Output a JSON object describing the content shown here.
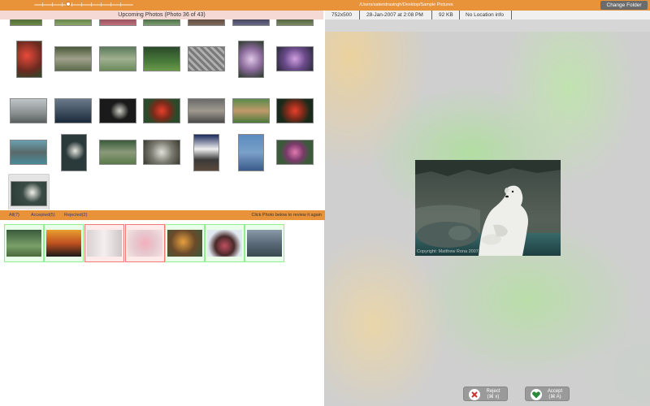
{
  "topbar": {
    "path": "/Users/satendrasingh/Desktop/Sample Pictures",
    "change_folder_label": "Change Folder"
  },
  "upcoming": {
    "header": "Upcoming Photos (Photo 36 of 43)"
  },
  "filters": {
    "all_label": "All(7)",
    "accepted_label": "Accepted(5)",
    "rejected_label": "Rejected(2)",
    "hint": "Click Photo below to review it again"
  },
  "review_items": [
    {
      "status": "accepted"
    },
    {
      "status": "accepted"
    },
    {
      "status": "rejected"
    },
    {
      "status": "rejected"
    },
    {
      "status": "accepted"
    },
    {
      "status": "accepted"
    },
    {
      "status": "accepted"
    }
  ],
  "info": {
    "dimensions": "752x500",
    "date": "28-Jan-2007 at 2:08 PM",
    "size": "92 KB",
    "location": "No Location info"
  },
  "photo": {
    "copyright": "Copyright: Matthew Rona 2007"
  },
  "actions": {
    "reject_label": "Reject",
    "reject_shortcut": "(⌘ x)",
    "accept_label": "Accept",
    "accept_shortcut": "(⌘ A)",
    "reject_icon": "x-circle-icon",
    "accept_icon": "heart-icon"
  },
  "colors": {
    "accent": "#e8923a",
    "accepted_border": "#8ef08e",
    "rejected_border": "#f07a7a"
  }
}
